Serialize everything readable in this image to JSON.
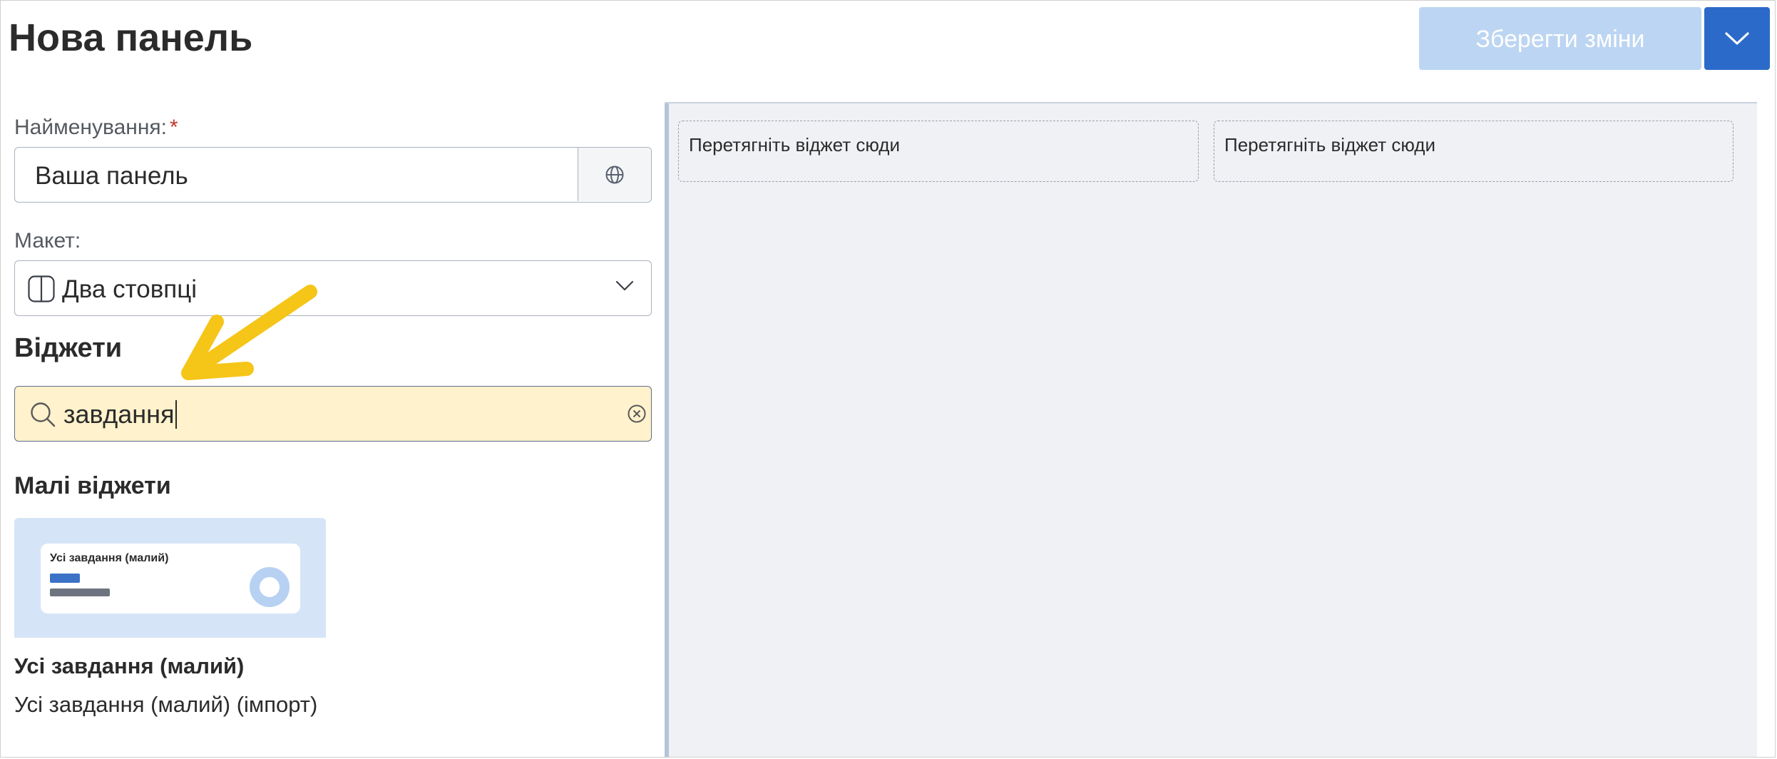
{
  "header": {
    "title": "Нова панель",
    "save_label": "Зберегти зміни",
    "split_icon": "chevron-down-icon"
  },
  "form": {
    "name_label": "Найменування:",
    "required_mark": "*",
    "name_value": "Ваша панель",
    "translate_icon": "globe-icon",
    "layout_label": "Макет:",
    "layout_value": "Два стовпці",
    "layout_icon": "two-columns-icon"
  },
  "widgets": {
    "section_title": "Віджети",
    "search_value": "завдання",
    "search_icon": "search-icon",
    "clear_icon": "clear-icon",
    "group_title": "Малі віджети",
    "items": [
      {
        "preview_title": "Усі завдання (малий)",
        "name": "Усі завдання (малий)",
        "description": "Усі завдання (малий) (імпорт)"
      }
    ]
  },
  "canvas": {
    "drop_zones": [
      "Перетягніть віджет сюди",
      "Перетягніть віджет сюди"
    ]
  },
  "colors": {
    "accent": "#2c6ac9",
    "save_disabled": "#bcd5f2",
    "search_highlight": "#fff2cc",
    "annotation_arrow": "#f5c518",
    "canvas_bg": "#f0f1f5"
  }
}
